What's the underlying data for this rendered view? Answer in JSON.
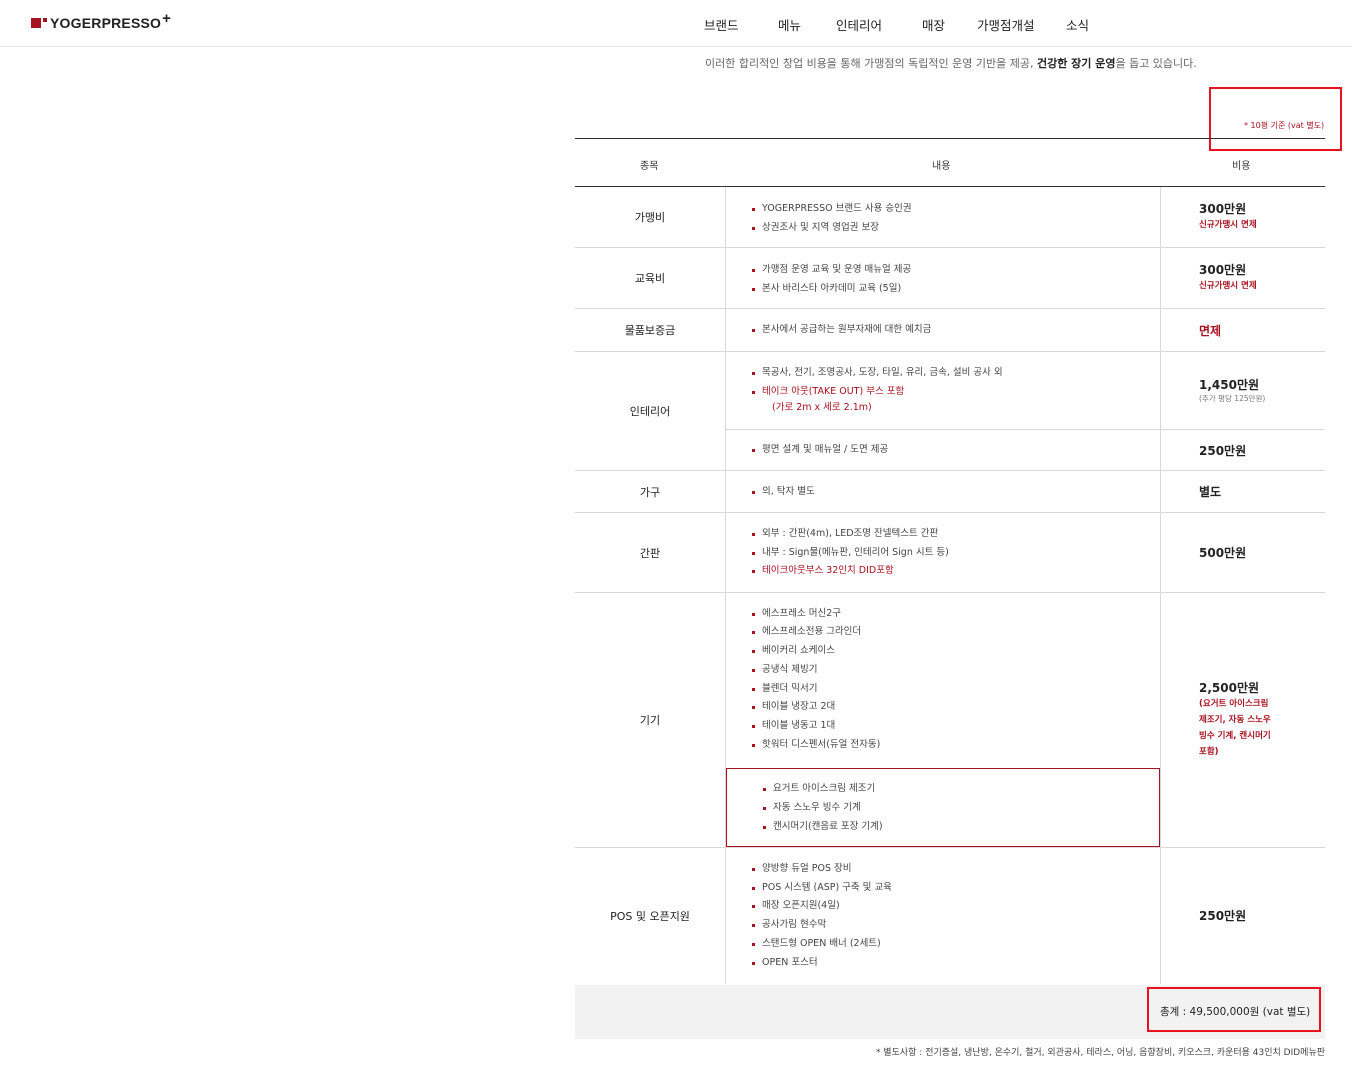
{
  "header": {
    "logo_text": "YOGERPRESSO",
    "logo_plus": "+",
    "nav": [
      "브랜드",
      "메뉴",
      "인테리어",
      "매장",
      "가맹점개설",
      "소식"
    ]
  },
  "intro": {
    "text_before": "이러한 합리적인 창업 비용을 통해 가맹점의 독립적인 운영 기반을 제공, ",
    "bold": "건강한 장기 운영",
    "text_after": "을 돕고 있습니다."
  },
  "note": "* 10평 기준 (vat 별도)",
  "table": {
    "headers": [
      "종목",
      "내용",
      "비용"
    ],
    "rows": [
      {
        "category": "가맹비",
        "items": [
          "YOGERPRESSO 브랜드 사용 승인권",
          "상권조사 및 지역 영업권 보장"
        ],
        "cost": "300만원",
        "cost_note": "신규가맹시 면제"
      },
      {
        "category": "교육비",
        "items": [
          "가맹점 운영 교육 및 운영 매뉴얼 제공",
          "본사 바리스타 아카데미 교육 (5일)"
        ],
        "cost": "300만원",
        "cost_note": "신규가맹시 면제"
      },
      {
        "category": "물품보증금",
        "items": [
          "본사에서 공급하는 원부자재에 대한 예치금"
        ],
        "cost": "면제"
      },
      {
        "category": "인테리어",
        "items": [
          "목공사, 전기, 조명공사, 도장, 타일, 유리, 금속, 설비 공사 외",
          "테이크 아웃(TAKE OUT) 부스 포함",
          "(가로 2m x 세로 2.1m)"
        ],
        "cost": "1,450만원",
        "cost_note": "(추가 평당 125만원)",
        "sub_items": [
          "평면 설계 및 매뉴얼 / 도면 제공"
        ],
        "sub_cost": "250만원"
      },
      {
        "category": "가구",
        "items": [
          "의, 탁자 별도"
        ],
        "cost": "별도"
      },
      {
        "category": "간판",
        "items": [
          "외부 : 간판(4m), LED조명 잔넬텍스트 간판",
          "내부 : Sign물(메뉴판, 인테리어 Sign 시트 등)",
          "테이크아웃부스 32인치 DID포함"
        ],
        "cost": "500만원"
      },
      {
        "category": "기기",
        "items": [
          "에스프레소 머신2구",
          "에스프레소전용 그라인더",
          "베이커리 쇼케이스",
          "공냉식 제빙기",
          "블렌더 믹서기",
          "테이블 냉장고 2대",
          "테이블 냉동고 1대",
          "핫워터 디스펜서(듀얼 전자동)"
        ],
        "boxed_items": [
          "요거트 아이스크림 제조기",
          "자동 스노우 빙수 기계",
          "캔시머기(캔음료 포장 기계)"
        ],
        "cost": "2,500만원",
        "cost_note_lines": [
          "(요거트 아이스크림",
          "제조기, 자동 스노우",
          "빙수 기계, 캔시머기",
          "포함)"
        ]
      },
      {
        "category": "POS 및 오픈지원",
        "items": [
          "양방향 듀얼 POS 장비",
          "POS 시스템 (ASP) 구축 및 교육",
          "매장 오픈지원(4일)",
          "공사가림 현수막",
          "스탠드형 OPEN 배너 (2세트)",
          "OPEN 포스터"
        ],
        "cost": "250만원"
      }
    ]
  },
  "total": "총계 : 49,500,000원 (vat 별도)",
  "footnote": "* 별도사항 : 전기증설, 냉난방, 온수기, 철거, 외관공사, 테라스, 어닝, 음향장비, 키오스크, 카운터용 43인치 DID메뉴판",
  "colors": {
    "accent": "#a8111f",
    "highlight_box": "#e8131f"
  }
}
